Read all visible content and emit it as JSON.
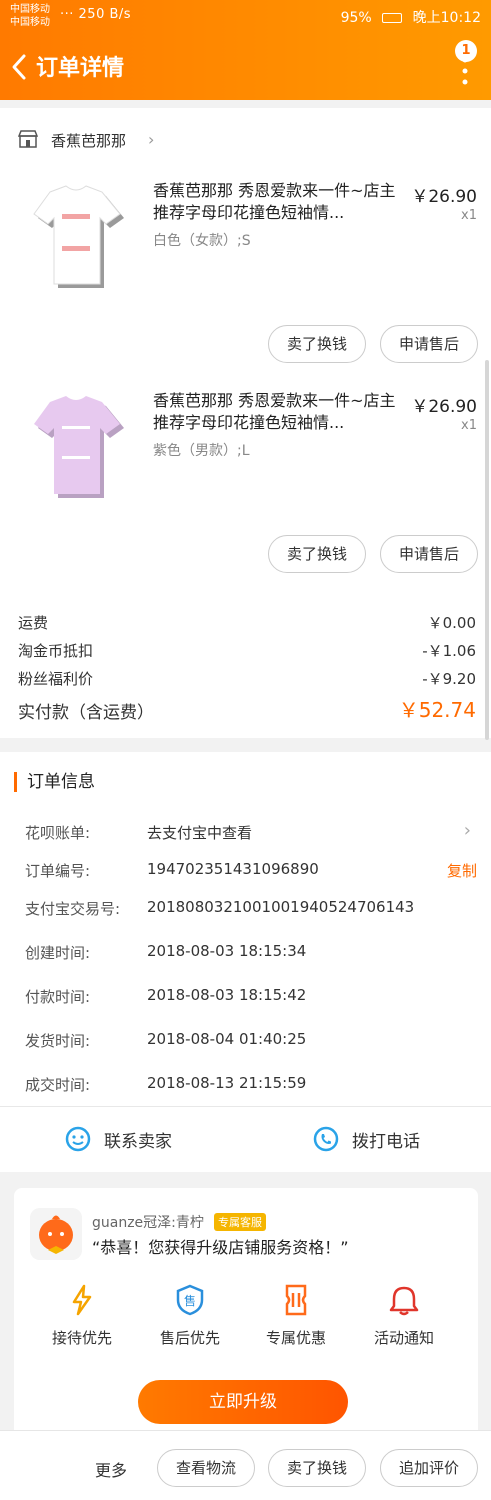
{
  "status_bar": {
    "carrier1": "中国移动",
    "carrier2": "中国移动",
    "speed": "··· 250 B/s",
    "battery": "95%",
    "time": "晚上10:12"
  },
  "header": {
    "title": "订单详情",
    "badge_count": "1"
  },
  "shop": {
    "name": "香蕉芭那那",
    "chevron": "›"
  },
  "items": [
    {
      "title": "香蕉芭那那  秀恩爱款来一件~店主推荐字母印花撞色短袖情...",
      "sku": "白色（女款）;S",
      "price": "￥26.90",
      "qty": "x1",
      "btn_exchange": "卖了换钱",
      "btn_aftersale": "申请售后",
      "shirt_color": "#ffffff"
    },
    {
      "title": "香蕉芭那那  秀恩爱款来一件~店主推荐字母印花撞色短袖情...",
      "sku": "紫色（男款）;L",
      "price": "￥26.90",
      "qty": "x1",
      "btn_exchange": "卖了换钱",
      "btn_aftersale": "申请售后",
      "shirt_color": "#e7c9ef"
    }
  ],
  "fees": {
    "shipping_label": "运费",
    "shipping_value": "￥0.00",
    "coin_label": "淘金币抵扣",
    "coin_value": "-￥1.06",
    "fan_label": "粉丝福利价",
    "fan_value": "-￥9.20",
    "total_label": "实付款（含运费）",
    "total_value": "￥52.74"
  },
  "order_info": {
    "section_title": "订单信息",
    "huabei_label": "花呗账单:",
    "huabei_value": "去支付宝中查看",
    "order_no_label": "订单编号:",
    "order_no_value": "194702351431096890",
    "copy_label": "复制",
    "alipay_no_label": "支付宝交易号:",
    "alipay_no_value": "2018080321001001940524706143",
    "created_label": "创建时间:",
    "created_value": "2018-08-03 18:15:34",
    "paid_label": "付款时间:",
    "paid_value": "2018-08-03 18:15:42",
    "shipped_label": "发货时间:",
    "shipped_value": "2018-08-04 01:40:25",
    "done_label": "成交时间:",
    "done_value": "2018-08-13 21:15:59"
  },
  "contact": {
    "seller_label": "联系卖家",
    "phone_label": "拨打电话"
  },
  "promo": {
    "name": "guanze冠泽:青柠",
    "tag": "专属客服",
    "message": "“恭喜！您获得升级店铺服务资格！”",
    "perks": [
      "接待优先",
      "售后优先",
      "专属优惠",
      "活动通知"
    ],
    "upgrade_label": "立即升级"
  },
  "bottom": {
    "more": "更多",
    "logistics": "查看物流",
    "exchange": "卖了换钱",
    "review": "追加评价"
  },
  "colors": {
    "accent": "#ff6a00",
    "header_from": "#ff7a00",
    "header_to": "#ff9a00"
  }
}
